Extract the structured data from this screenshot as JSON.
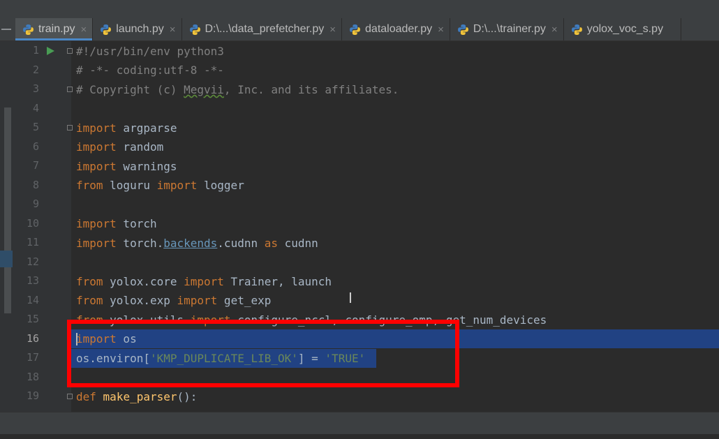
{
  "tabs": [
    {
      "label": "train.py",
      "active": true,
      "closable": true
    },
    {
      "label": "launch.py",
      "active": false,
      "closable": true
    },
    {
      "label": "D:\\...\\data_prefetcher.py",
      "active": false,
      "closable": true
    },
    {
      "label": "dataloader.py",
      "active": false,
      "closable": true
    },
    {
      "label": "D:\\...\\trainer.py",
      "active": false,
      "closable": true
    },
    {
      "label": "yolox_voc_s.py",
      "active": false,
      "closable": false
    }
  ],
  "close_glyph": "×",
  "line_numbers": [
    "1",
    "2",
    "3",
    "4",
    "5",
    "6",
    "7",
    "8",
    "9",
    "10",
    "11",
    "12",
    "13",
    "14",
    "15",
    "16",
    "17",
    "18",
    "19"
  ],
  "current_line": "16",
  "code": {
    "l1": "#!/usr/bin/env python3",
    "l2": "# -*- coding:utf-8 -*-",
    "l3_a": "# Copyright (c) ",
    "l3_b": "Megvii",
    "l3_c": ", Inc. and its affiliates.",
    "import": "import",
    "from": "from",
    "as": "as",
    "def": "def",
    "l5": " argparse",
    "l6": " random",
    "l7": " warnings",
    "l8_mod": " loguru ",
    "l8_name": " logger",
    "l10": " torch",
    "l11_a": " torch.",
    "l11_b": "backends",
    "l11_c": ".cudnn ",
    "l11_d": " cudnn",
    "l13_mod": " yolox.core ",
    "l13_names": " Trainer, launch",
    "l14_mod": " yolox.exp ",
    "l14_names": " get_exp",
    "l15_mod": " yolox.utils ",
    "l15_names": " configure_nccl, configure_omp, get_num_devices",
    "l16": " os",
    "l17_a": "os.environ[",
    "l17_b": "'KMP_DUPLICATE_LIB_OK'",
    "l17_c": "] = ",
    "l17_d": "'TRUE'",
    "l19_a": " ",
    "l19_b": "make_parser",
    "l19_c": "():"
  },
  "colors": {
    "keyword": "#cc7832",
    "comment": "#808080",
    "string": "#6a8759",
    "function": "#ffc66d",
    "selection": "#214283",
    "annotation_box": "#ff0000"
  }
}
